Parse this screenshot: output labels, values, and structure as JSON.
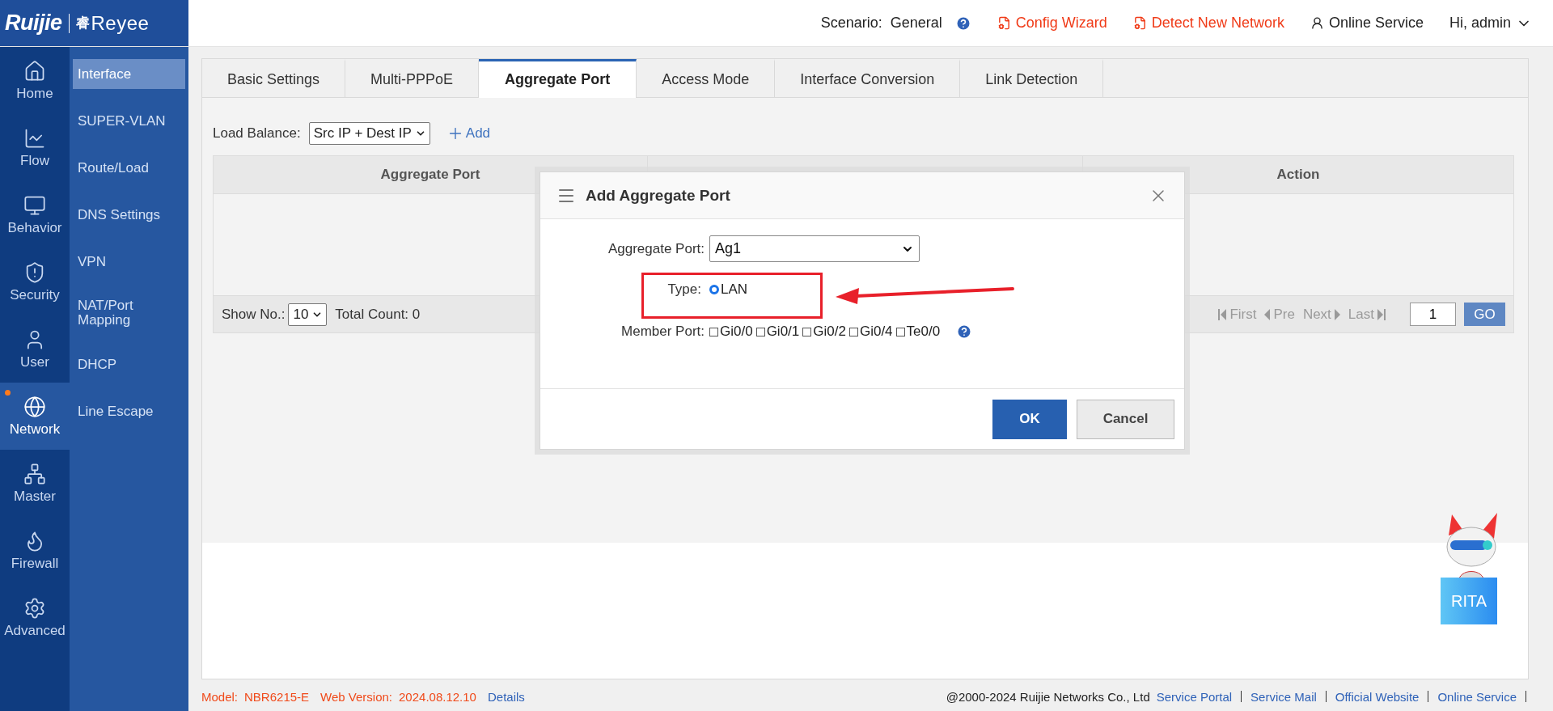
{
  "header": {
    "logo": {
      "brand": "Ruijie",
      "mark": "睿",
      "sub_brand": "Reyee"
    },
    "scenario_label": "Scenario:",
    "scenario_value": "General",
    "links": [
      {
        "label": "Config Wizard",
        "kind": "alert"
      },
      {
        "label": "Detect New Network",
        "kind": "alert"
      },
      {
        "label": "Online Service",
        "kind": "support"
      }
    ],
    "user": "Hi, admin"
  },
  "rail": [
    {
      "label": "Home",
      "selected": false,
      "badge": false
    },
    {
      "label": "Flow",
      "selected": false,
      "badge": false
    },
    {
      "label": "Behavior",
      "selected": false,
      "badge": false
    },
    {
      "label": "Security",
      "selected": false,
      "badge": false
    },
    {
      "label": "User",
      "selected": false,
      "badge": false
    },
    {
      "label": "Network",
      "selected": true,
      "badge": true
    },
    {
      "label": "Master",
      "selected": false,
      "badge": false
    },
    {
      "label": "Firewall",
      "selected": false,
      "badge": false
    },
    {
      "label": "Advanced",
      "selected": false,
      "badge": false
    }
  ],
  "subnav": [
    {
      "label": "Interface",
      "selected": true
    },
    {
      "label": "SUPER-VLAN",
      "selected": false
    },
    {
      "label": "Route/Load",
      "selected": false
    },
    {
      "label": "DNS Settings",
      "selected": false
    },
    {
      "label": "VPN",
      "selected": false
    },
    {
      "label": "NAT/Port Mapping",
      "selected": false
    },
    {
      "label": "DHCP",
      "selected": false
    },
    {
      "label": "Line Escape",
      "selected": false
    }
  ],
  "tabs": [
    {
      "label": "Basic Settings",
      "selected": false
    },
    {
      "label": "Multi-PPPoE",
      "selected": false
    },
    {
      "label": "Aggregate Port",
      "selected": true
    },
    {
      "label": "Access Mode",
      "selected": false
    },
    {
      "label": "Interface Conversion",
      "selected": false
    },
    {
      "label": "Link Detection",
      "selected": false
    }
  ],
  "load_balance": {
    "label": "Load Balance:",
    "value": "Src IP + Dest IP"
  },
  "add_button": "Add",
  "table": {
    "columns": [
      "Aggregate Port",
      "Action"
    ]
  },
  "pager": {
    "show_label": "Show No.:",
    "page_size": "10",
    "total": "Total Count: 0",
    "first": "First",
    "pre": "Pre",
    "next": "Next",
    "last": "Last",
    "page": "1",
    "go": "GO"
  },
  "dialog": {
    "title": "Add Aggregate Port",
    "port_label": "Aggregate Port:",
    "port_value": "Ag1",
    "type_label": "Type:",
    "type_options": [
      {
        "label": "LAN",
        "selected": true
      }
    ],
    "member_label": "Member Port:",
    "members": [
      {
        "label": "Gi0/0",
        "checked": false
      },
      {
        "label": "Gi0/1",
        "checked": false
      },
      {
        "label": "Gi0/2",
        "checked": false
      },
      {
        "label": "Gi0/4",
        "checked": false
      },
      {
        "label": "Te0/0",
        "checked": false
      }
    ],
    "ok": "OK",
    "cancel": "Cancel"
  },
  "assistant": {
    "label": "RITA"
  },
  "footer": {
    "model_label": "Model:",
    "model": "NBR6215-E",
    "version_label": "Web Version:",
    "version": "2024.08.12.10",
    "details": "Details",
    "copyright": "@2000-2024 Ruijie Networks Co., Ltd",
    "links": [
      "Service Portal",
      "Service Mail",
      "Official Website",
      "Online Service"
    ]
  }
}
